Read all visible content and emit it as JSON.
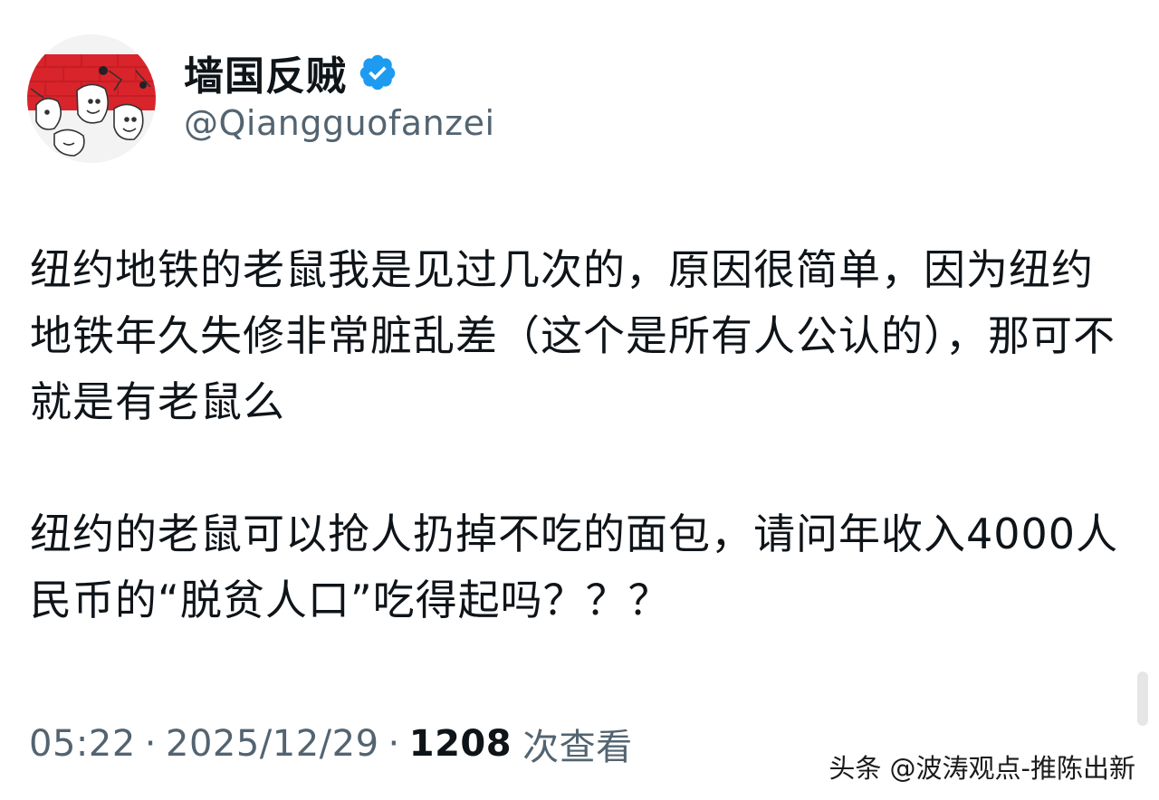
{
  "author": {
    "display_name": "墙国反贼",
    "handle": "@Qiangguofanzei",
    "verified_icon": "verified-badge-icon",
    "avatar_icon": "cartoon-avatar-icon",
    "verified_color": "#1d9bf0"
  },
  "tweet": {
    "paragraphs": [
      "纽约地铁的老鼠我是见过几次的，原因很简单，因为纽约地铁年久失修非常脏乱差（这个是所有人公认的），那可不就是有老鼠么",
      "纽约的老鼠可以抢人扔掉不吃的面包，请问年收入4000人民币的“脱贫人口”吃得起吗？？？"
    ]
  },
  "meta": {
    "time": "05:22",
    "separator": "·",
    "date": "2025/12/29",
    "views_count": "1208",
    "views_label": "次查看"
  },
  "watermark": {
    "text": "头条 @波涛观点-推陈出新"
  },
  "colors": {
    "text_primary": "#0f1419",
    "text_secondary": "#536471",
    "avatar_red": "#d9242b"
  }
}
